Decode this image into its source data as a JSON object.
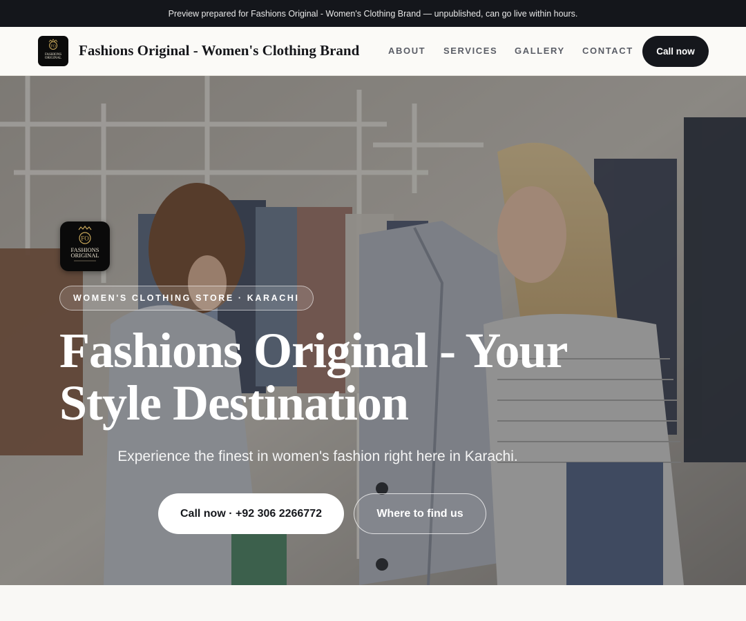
{
  "announcement": "Preview prepared for Fashions Original - Women's Clothing Brand — unpublished, can go live within hours.",
  "nav": {
    "brand_name": "Fashions Original - Women's Clothing Brand",
    "links": [
      "ABOUT",
      "SERVICES",
      "GALLERY",
      "CONTACT"
    ],
    "cta_label": "Call now"
  },
  "logo": {
    "monogram": "FO",
    "line1": "FASHIONS",
    "line2": "ORIGINAL"
  },
  "hero": {
    "eyebrow": "WOMEN'S CLOTHING STORE · KARACHI",
    "title": "Fashions Original - Your Style Destination",
    "subtitle": "Experience the finest in women's fashion right here in Karachi.",
    "primary_button": "Call now · +92 306 2266772",
    "secondary_button": "Where to find us"
  },
  "colors": {
    "dark": "#14161b",
    "cream": "#f9f8f5",
    "logo_gold": "#c9a85a"
  }
}
